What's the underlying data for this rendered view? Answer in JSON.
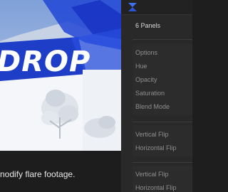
{
  "preview": {
    "title_text": "DROP",
    "caption": "nodify flare footage."
  },
  "panel": {
    "panel_count_label": "6 Panels",
    "groups": [
      [
        "Options",
        "Hue",
        "Opacity",
        "Saturation",
        "Blend Mode"
      ],
      [
        "Vertical Flip",
        "Horizontal Flip"
      ],
      [
        "Vertical Flip",
        "Horizontal Flip"
      ]
    ]
  },
  "colors": {
    "accent_blue": "#1e3ec8",
    "panel_bg": "#292929"
  },
  "icons": {
    "logo": "hourglass-logo-icon"
  }
}
